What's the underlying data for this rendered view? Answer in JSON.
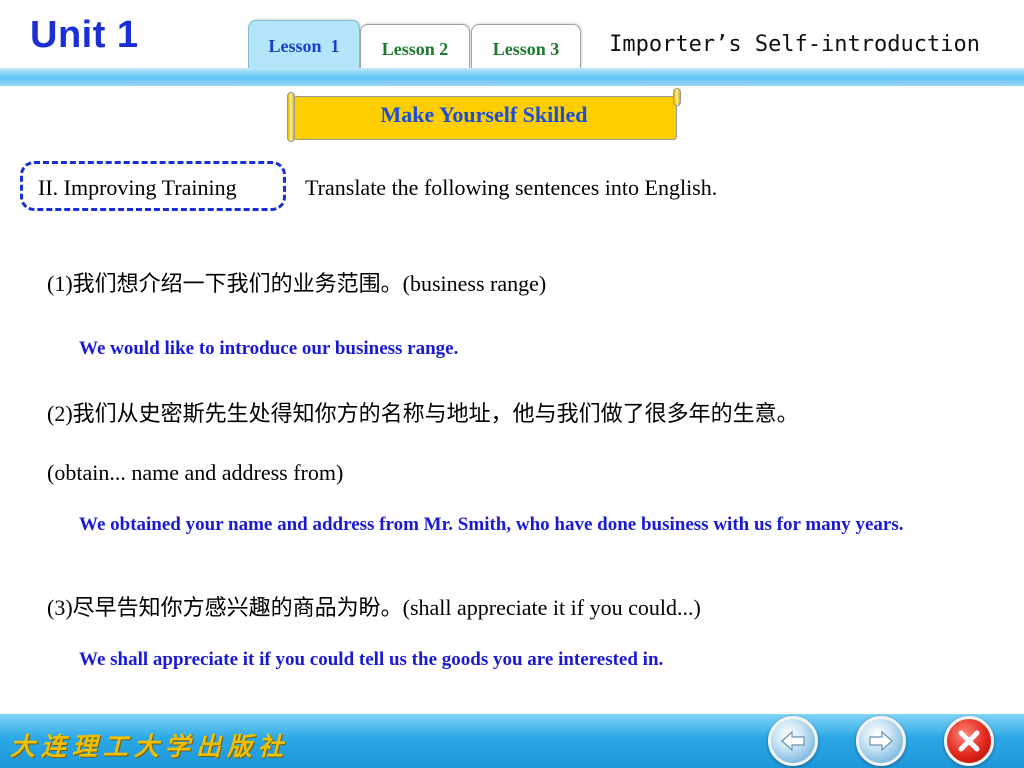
{
  "header": {
    "unit_title": "Unit 1",
    "tabs": [
      {
        "label": "Lesson  1",
        "active": true
      },
      {
        "label": "Lesson 2",
        "active": false
      },
      {
        "label": "Lesson 3",
        "active": false
      }
    ],
    "slide_title": "Importer’s Self-introduction"
  },
  "banner": {
    "text": "Make Yourself Skilled"
  },
  "section": {
    "label": "II. Improving Training",
    "instruction": "Translate the following sentences into English."
  },
  "items": [
    {
      "question": "(1)我们想介绍一下我们的业务范围。(business range)",
      "answer": "We would like to introduce our business range."
    },
    {
      "question": "(2)我们从史密斯先生处得知你方的名称与地址，他与我们做了很多年的生意。",
      "question_hint": "(obtain... name and address from)",
      "answer": "We obtained your name and address from Mr. Smith, who have done business with us for many years."
    },
    {
      "question": "(3)尽早告知你方感兴趣的商品为盼。(shall appreciate it if you could...)",
      "answer": "We shall appreciate it if you could tell us the goods you are interested in."
    }
  ],
  "footer": {
    "publisher": "大连理工大学出版社",
    "nav": {
      "prev_icon": "arrow-left-icon",
      "next_icon": "arrow-right-icon",
      "close_icon": "close-icon"
    }
  },
  "colors": {
    "accent_blue": "#1a2fd6",
    "answer_blue": "#1a1ad6",
    "banner_yellow": "#ffce00",
    "active_tab": "#b3e6fa",
    "footer_blue": "#2ba8e6"
  }
}
